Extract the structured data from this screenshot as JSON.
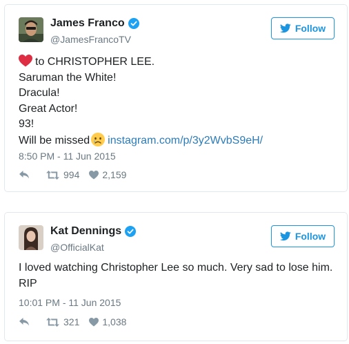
{
  "tweets": [
    {
      "author": {
        "name": "James Franco",
        "handle": "@JamesFrancoTV"
      },
      "follow_label": "Follow",
      "text": {
        "line1": "to CHRISTOPHER LEE.",
        "line2": "Saruman the White!",
        "line3": "Dracula!",
        "line4": "Great Actor!",
        "line5": "93!",
        "line6": "Will be missed",
        "link": "instagram.com/p/3y2WvbS9eH/"
      },
      "timestamp": "8:50 PM - 11 Jun 2015",
      "retweets": "994",
      "likes": "2,159"
    },
    {
      "author": {
        "name": "Kat Dennings",
        "handle": "@OfficialKat"
      },
      "follow_label": "Follow",
      "text": {
        "line1": "I loved watching Christopher Lee so much. Very sad to lose him.",
        "line2": "RIP"
      },
      "timestamp": "10:01 PM - 11 Jun 2015",
      "retweets": "321",
      "likes": "1,038"
    }
  ],
  "colors": {
    "accent": "#1b95e0",
    "link": "#2b7bb9",
    "meta": "#697882",
    "border": "#e1e8ed",
    "heart": "#e0245e"
  }
}
